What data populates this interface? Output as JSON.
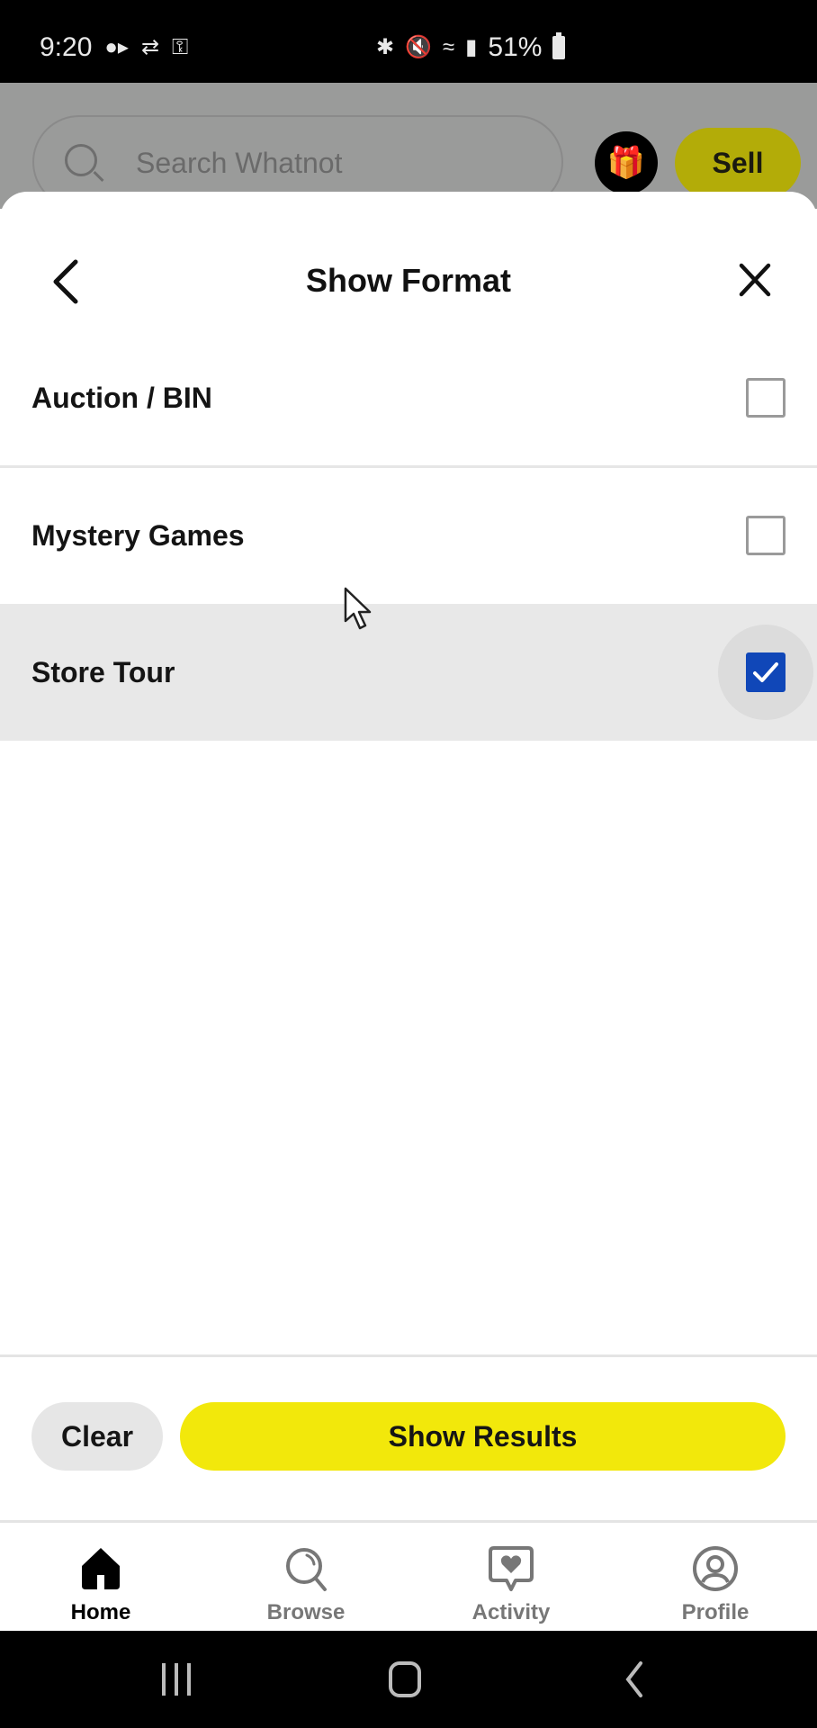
{
  "status_bar": {
    "time": "9:20",
    "left_icons": [
      "video-record-icon",
      "vpn-sync-icon",
      "key-icon"
    ],
    "right_icons": [
      "bluetooth-icon",
      "mute-icon",
      "wifi-icon",
      "signal-icon"
    ],
    "battery": "51%"
  },
  "app_header": {
    "search_placeholder": "Search Whatnot",
    "gift_icon": "gift-icon",
    "sell_label": "Sell"
  },
  "sheet": {
    "title": "Show Format",
    "back_icon": "chevron-left-icon",
    "close_icon": "close-icon",
    "options": [
      {
        "label": "Auction / BIN",
        "checked": false
      },
      {
        "label": "Mystery Games",
        "checked": false
      },
      {
        "label": "Store Tour",
        "checked": true
      }
    ],
    "clear_label": "Clear",
    "show_results_label": "Show Results"
  },
  "colors": {
    "accent_yellow": "#f2e80b",
    "checkbox_blue": "#1047b8",
    "highlight_row": "#e8e8e8"
  },
  "tabbar": {
    "items": [
      {
        "label": "Home",
        "icon": "home-icon",
        "active": true
      },
      {
        "label": "Browse",
        "icon": "browse-search-icon",
        "active": false
      },
      {
        "label": "Activity",
        "icon": "activity-heart-icon",
        "active": false
      },
      {
        "label": "Profile",
        "icon": "profile-icon",
        "active": false
      }
    ]
  },
  "navbar": {
    "items": [
      "recent-apps-icon",
      "home-button-icon",
      "back-icon"
    ]
  }
}
